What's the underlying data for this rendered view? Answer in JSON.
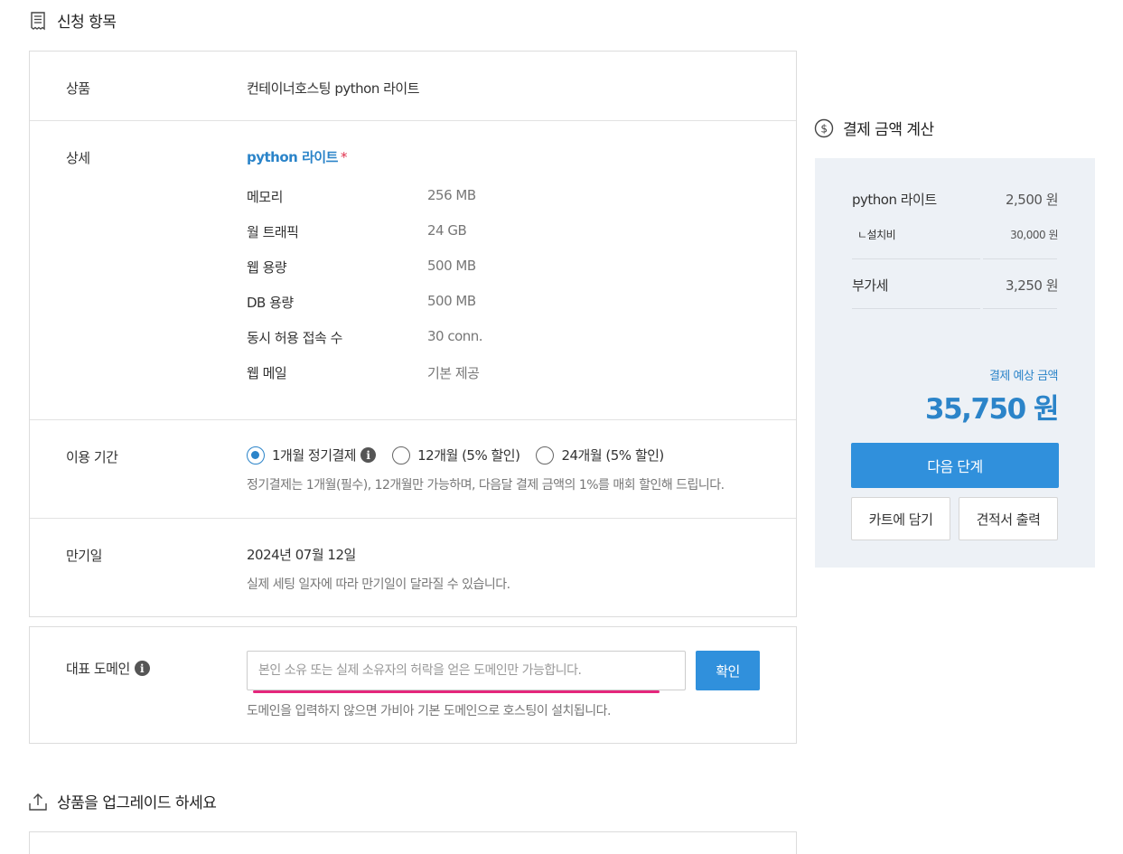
{
  "order_section": {
    "title": "신청 항목",
    "icon": "receipt-icon"
  },
  "product": {
    "label": "상품",
    "value": "컨테이너호스팅  python 라이트"
  },
  "detail": {
    "label": "상세",
    "plan_name": "python 라이트",
    "required_mark": "*",
    "specs": [
      {
        "key": "메모리",
        "value": "256 MB"
      },
      {
        "key": "월 트래픽",
        "value": "24 GB"
      },
      {
        "key": "웹 용량",
        "value": "500 MB"
      },
      {
        "key": "DB 용량",
        "value": "500 MB"
      },
      {
        "key": "동시 허용 접속 수",
        "value": "30 conn."
      },
      {
        "key": "웹 메일",
        "value": "기본 제공"
      }
    ]
  },
  "period": {
    "label": "이용 기간",
    "options": [
      {
        "label": "1개월 정기결제",
        "selected": true
      },
      {
        "label": "12개월 (5% 할인)",
        "selected": false
      },
      {
        "label": "24개월 (5% 할인)",
        "selected": false
      }
    ],
    "info_icon": "i",
    "note": "정기결제는 1개월(필수), 12개월만 가능하며, 다음달 결제 금액의 1%를 매회 할인해 드립니다."
  },
  "expiry": {
    "label": "만기일",
    "date": "2024년 07월 12일",
    "note": "실제 세팅 일자에 따라 만기일이 달라질 수 있습니다."
  },
  "domain": {
    "label": "대표 도메인",
    "info_icon": "i",
    "input_value": "",
    "placeholder": "본인 소유 또는 실제 소유자의 허락을 얻은 도메인만 가능합니다.",
    "confirm_label": "확인",
    "note": "도메인을 입력하지 않으면 가비아 기본 도메인으로 호스팅이 설치됩니다.",
    "highlight_color": "#e5267c"
  },
  "upgrade_section": {
    "title": "상품을 업그레이드 하세요",
    "icon": "upload-icon"
  },
  "payment": {
    "title": "결제 금액 계산",
    "icon": "dollar-circle-icon",
    "lines": [
      {
        "key": "python 라이트",
        "value": "2,500 원"
      },
      {
        "key": "ㄴ설치비",
        "value": "30,000 원"
      },
      {
        "key": "부가세",
        "value": "3,250 원"
      }
    ],
    "estimate_label": "결제 예상 금액",
    "estimate_amount": "35,750 원",
    "next_label": "다음 단계",
    "cart_label": "카트에 담기",
    "quote_label": "견적서 출력"
  },
  "colors": {
    "accent": "#2b84c9",
    "button": "#3090dc",
    "panel_bg": "#edf1f6"
  }
}
